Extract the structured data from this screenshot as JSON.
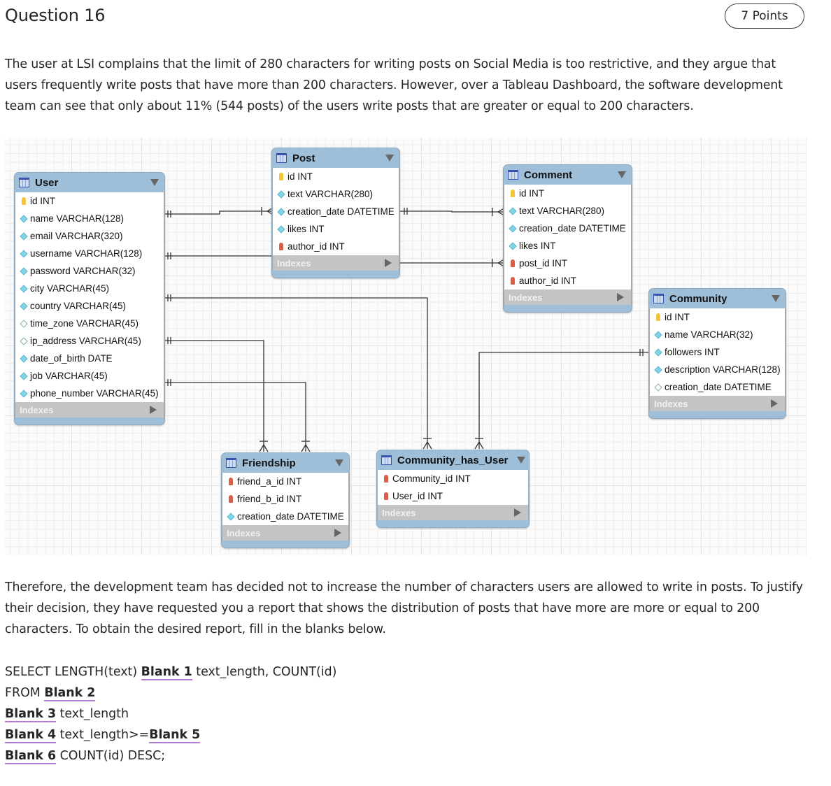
{
  "question": {
    "title": "Question 16",
    "points": "7 Points"
  },
  "intro_text": "The user at LSI complains that the limit of 280 characters for writing posts on Social Media is too restrictive, and they argue that users frequently write posts that have more than 200 characters. However, over a Tableau Dashboard, the software development team can see that only about 11% (544 posts) of the users write posts that are greater or equal to 200 characters.",
  "diagram": {
    "indexes_label": "Indexes",
    "tables": {
      "user": {
        "name": "User",
        "columns": [
          {
            "text": "id INT",
            "icon": "primary-key"
          },
          {
            "text": "name VARCHAR(128)",
            "icon": "column"
          },
          {
            "text": "email VARCHAR(320)",
            "icon": "column"
          },
          {
            "text": "username VARCHAR(128)",
            "icon": "column"
          },
          {
            "text": "password VARCHAR(32)",
            "icon": "column"
          },
          {
            "text": "city VARCHAR(45)",
            "icon": "column"
          },
          {
            "text": "country VARCHAR(45)",
            "icon": "column"
          },
          {
            "text": "time_zone VARCHAR(45)",
            "icon": "nullable-column"
          },
          {
            "text": "ip_address VARCHAR(45)",
            "icon": "nullable-column"
          },
          {
            "text": "date_of_birth DATE",
            "icon": "column"
          },
          {
            "text": "job VARCHAR(45)",
            "icon": "column"
          },
          {
            "text": "phone_number VARCHAR(45)",
            "icon": "column"
          }
        ]
      },
      "post": {
        "name": "Post",
        "columns": [
          {
            "text": "id INT",
            "icon": "primary-key"
          },
          {
            "text": "text VARCHAR(280)",
            "icon": "column"
          },
          {
            "text": "creation_date DATETIME",
            "icon": "column"
          },
          {
            "text": "likes INT",
            "icon": "column"
          },
          {
            "text": "author_id INT",
            "icon": "foreign-key"
          }
        ]
      },
      "comment": {
        "name": "Comment",
        "columns": [
          {
            "text": "id INT",
            "icon": "primary-key"
          },
          {
            "text": "text VARCHAR(280)",
            "icon": "column"
          },
          {
            "text": "creation_date DATETIME",
            "icon": "column"
          },
          {
            "text": "likes INT",
            "icon": "column"
          },
          {
            "text": "post_id INT",
            "icon": "foreign-key"
          },
          {
            "text": "author_id INT",
            "icon": "foreign-key"
          }
        ]
      },
      "community": {
        "name": "Community",
        "columns": [
          {
            "text": "id INT",
            "icon": "primary-key"
          },
          {
            "text": "name VARCHAR(32)",
            "icon": "column"
          },
          {
            "text": "followers INT",
            "icon": "column"
          },
          {
            "text": "description VARCHAR(128)",
            "icon": "column"
          },
          {
            "text": "creation_date DATETIME",
            "icon": "nullable-column"
          }
        ]
      },
      "friendship": {
        "name": "Friendship",
        "columns": [
          {
            "text": "friend_a_id INT",
            "icon": "foreign-key"
          },
          {
            "text": "friend_b_id INT",
            "icon": "foreign-key"
          },
          {
            "text": "creation_date DATETIME",
            "icon": "column"
          }
        ]
      },
      "community_has_user": {
        "name": "Community_has_User",
        "columns": [
          {
            "text": "Community_id INT",
            "icon": "foreign-key"
          },
          {
            "text": "User_id INT",
            "icon": "foreign-key"
          }
        ]
      }
    }
  },
  "followup_text": "Therefore, the development team has decided not to increase the number of characters users are allowed to write in posts. To justify their decision, they have requested you a report that shows the distribution of posts that have more are more or equal to 200 characters. To obtain the desired report, fill in the blanks below.",
  "sql": {
    "line1_prefix": "SELECT LENGTH(text) ",
    "blank1": "Blank 1",
    "line1_suffix": " text_length, COUNT(id)",
    "line2_prefix": "FROM ",
    "blank2": "Blank 2",
    "blank3": "Blank 3",
    "line3_suffix": " text_length",
    "blank4": "Blank 4",
    "line4_mid": " text_length>=",
    "blank5": "Blank 5",
    "blank6": "Blank 6",
    "line6_suffix": " COUNT(id) DESC;"
  },
  "colors": {
    "blank_underline": "#b57ad1",
    "table_header": "#9fbfd9",
    "indexes_bar": "#c4c4c4"
  }
}
